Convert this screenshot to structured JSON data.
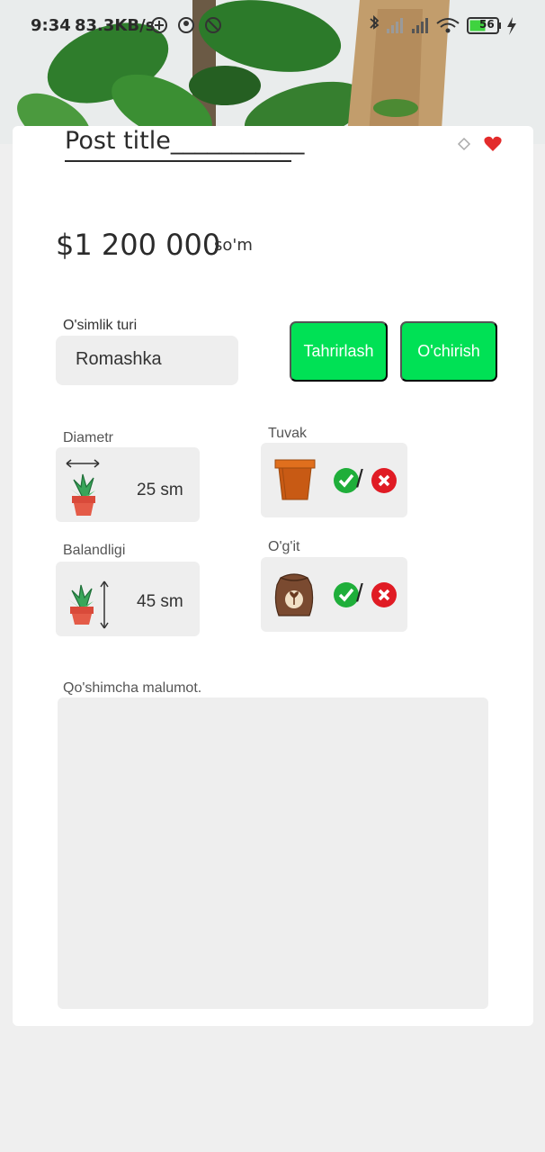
{
  "status_bar": {
    "time": "9:34",
    "speed": "83.3KB/s",
    "battery": "56"
  },
  "post": {
    "title": "Post title___________",
    "price": "$1 200 000",
    "currency": "so'm"
  },
  "plant_type": {
    "label": "O'simlik turi",
    "value": "Romashka"
  },
  "buttons": {
    "edit": "Tahrirlash",
    "delete": "O'chirish"
  },
  "specs": {
    "diameter_label": "Diametr",
    "diameter_value": "25 sm",
    "height_label": "Balandligi",
    "height_value": "45 sm",
    "pot_label": "Tuvak",
    "fertilizer_label": "O'g'it",
    "separator": "/"
  },
  "notes": {
    "label": "Qo'shimcha malumot."
  },
  "colors": {
    "accent": "#00e155",
    "field_bg": "#eeeeee",
    "check": "#1fae3a",
    "cross": "#e01b24"
  },
  "icons": [
    "plant-diameter-icon",
    "plant-height-icon",
    "pot-icon",
    "fertilizer-bag-icon",
    "check-icon",
    "cross-icon",
    "heart-icon"
  ]
}
